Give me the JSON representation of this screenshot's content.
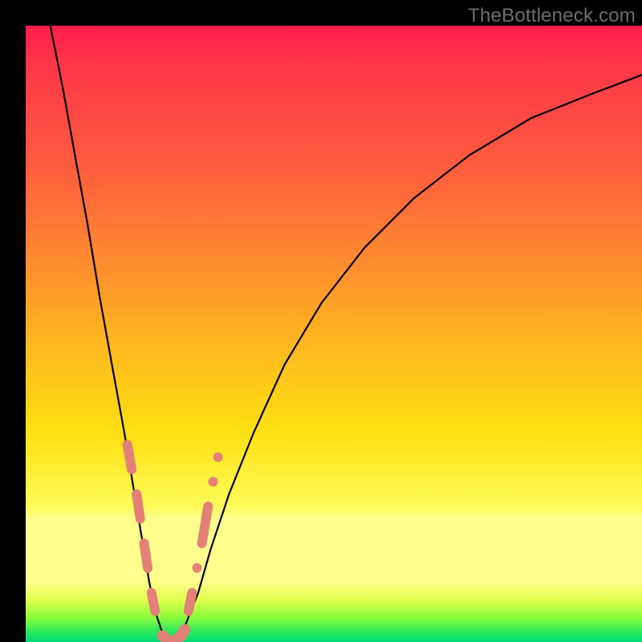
{
  "watermark": "TheBottleneck.com",
  "chart_data": {
    "type": "line",
    "title": "",
    "xlabel": "",
    "ylabel": "",
    "xlim": [
      0,
      100
    ],
    "ylim": [
      0,
      100
    ],
    "grid": false,
    "legend": false,
    "series": [
      {
        "name": "bottleneck-curve",
        "x": [
          4,
          6,
          8,
          10,
          12,
          14,
          16,
          18,
          19,
          20,
          21,
          22,
          23,
          24,
          25,
          26,
          28,
          30,
          33,
          37,
          42,
          48,
          55,
          63,
          72,
          82,
          92,
          100
        ],
        "y": [
          100,
          90,
          79,
          68,
          56,
          45,
          34,
          22,
          16,
          10,
          5,
          2,
          0,
          0,
          1,
          3,
          8,
          15,
          24,
          34,
          45,
          55,
          64,
          72,
          79,
          85,
          89,
          92
        ]
      }
    ],
    "markers": {
      "name": "sample-points",
      "comment": "pink salmon dots/pills clustered near the trough of the curve",
      "left_cluster_x": [
        16.5,
        17.2,
        18.0,
        18.6,
        19.2,
        19.8,
        20.4,
        21.0,
        21.6
      ],
      "left_cluster_y": [
        32,
        28,
        24,
        20,
        16,
        12,
        8,
        5,
        3
      ],
      "trough_x": [
        22.2,
        22.8,
        23.4,
        24.0,
        24.6,
        25.2,
        25.8
      ],
      "trough_y": [
        1,
        0.5,
        0,
        0,
        0.5,
        1,
        2
      ],
      "right_cluster_x": [
        26.4,
        27.0,
        27.8,
        28.6,
        29.6,
        30.4,
        31.2
      ],
      "right_cluster_y": [
        5,
        8,
        12,
        16,
        22,
        26,
        30
      ]
    },
    "background_gradient": {
      "top": "#ff1e4b",
      "mid": "#ffe011",
      "band": "#ffff8e",
      "bottom": "#00d977"
    }
  }
}
